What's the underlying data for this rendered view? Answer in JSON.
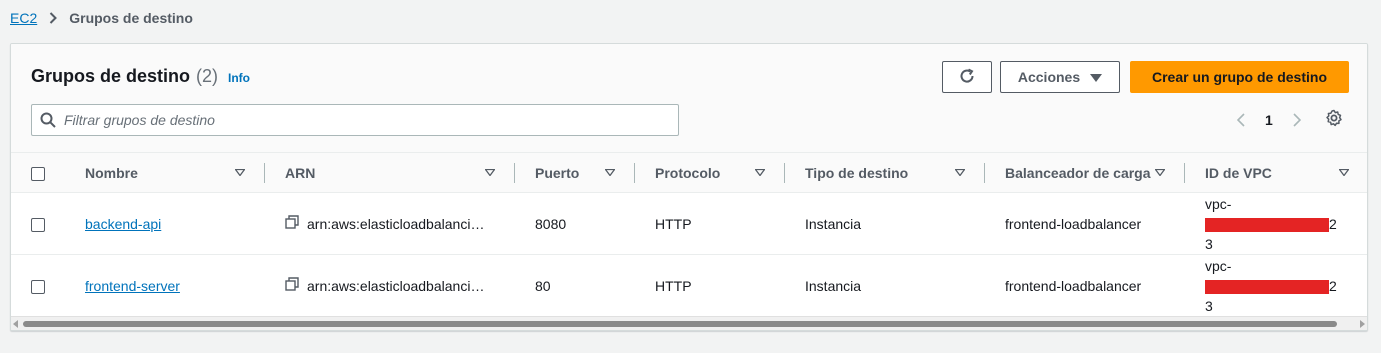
{
  "breadcrumb": {
    "root": "EC2",
    "current": "Grupos de destino"
  },
  "header": {
    "title": "Grupos de destino",
    "count": "(2)",
    "info": "Info",
    "actions_label": "Acciones",
    "create_label": "Crear un grupo de destino"
  },
  "search": {
    "placeholder": "Filtrar grupos de destino",
    "value": ""
  },
  "pagination": {
    "page": "1"
  },
  "columns": [
    "Nombre",
    "ARN",
    "Puerto",
    "Protocolo",
    "Tipo de destino",
    "Balanceador de carga",
    "ID de VPC"
  ],
  "rows": [
    {
      "name": "backend-api",
      "arn": "arn:aws:elasticloadbalancing:",
      "port": "8080",
      "protocol": "HTTP",
      "target_type": "Instancia",
      "load_balancer": "frontend-loadbalancer",
      "vpc_prefix": "vpc-",
      "vpc_suffix": "2",
      "vpc_line2": "3"
    },
    {
      "name": "frontend-server",
      "arn": "arn:aws:elasticloadbalancing:",
      "port": "80",
      "protocol": "HTTP",
      "target_type": "Instancia",
      "load_balancer": "frontend-loadbalancer",
      "vpc_prefix": "vpc-",
      "vpc_suffix": "2",
      "vpc_line2": "3"
    }
  ],
  "colors": {
    "primary": "#ff9900",
    "link": "#0073bb",
    "redaction": "#e42424"
  },
  "icons": [
    "chevron-right-icon",
    "refresh-icon",
    "caret-down-icon",
    "search-icon",
    "chevron-left-icon",
    "gear-icon",
    "sort-caret-icon",
    "copy-icon"
  ]
}
